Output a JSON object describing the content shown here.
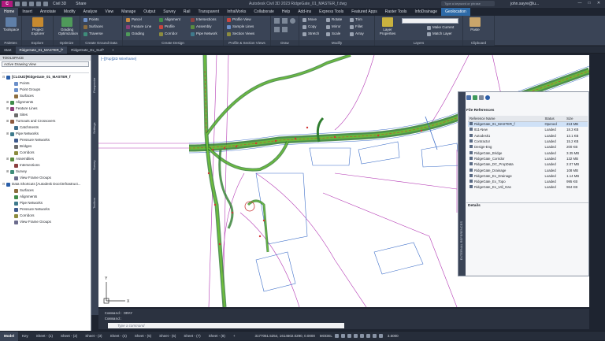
{
  "titlebar": {
    "logo": "C",
    "app_name": "Civil 3D",
    "share": "Share",
    "window_title": "Autodesk Civil 3D 2023   RidgeGate_01_MASTER_f.dwg",
    "search_placeholder": "Type a keyword or phrase",
    "user": "john.sayre@lu...",
    "minimize": "—",
    "maximize": "□",
    "close": "✕"
  },
  "tabs": [
    "Home",
    "Insert",
    "Annotate",
    "Modify",
    "Analyze",
    "View",
    "Manage",
    "Output",
    "Survey",
    "Rail",
    "Transparent",
    "InfraWorks",
    "Collaborate",
    "Help",
    "Add-ins",
    "Express Tools",
    "Featured Apps",
    "Raster Tools",
    "InfoDrainage",
    "Geolocation"
  ],
  "ribbon": {
    "palettes": {
      "title": "Palettes",
      "toolspace": "Toolspace"
    },
    "explore": {
      "title": "Explore",
      "project": "Project Explorer"
    },
    "optimize": {
      "title": "Optimize",
      "grading": "Grading Optimization"
    },
    "ground": {
      "title": "Create Ground Data",
      "items": [
        "Points",
        "Surfaces",
        "Traverse"
      ]
    },
    "design": {
      "title": "Create Design",
      "items": [
        "Parcel",
        "Feature Line",
        "Grading",
        "Alignment",
        "Profile",
        "Corridor",
        "Intersections",
        "Assembly",
        "Pipe Network"
      ]
    },
    "profile": {
      "title": "Profile & Section Views",
      "items": [
        "Profile View",
        "Sample Lines",
        "Section Views"
      ]
    },
    "draw": {
      "title": "Draw"
    },
    "modify": {
      "title": "Modify",
      "items": [
        "Move",
        "Copy",
        "Stretch",
        "Rotate",
        "Mirror",
        "Scale",
        "Trim",
        "Fillet",
        "Array"
      ]
    },
    "layers": {
      "title": "Layers",
      "props": "Layer Properties",
      "make_current": "Make Current",
      "match_layer": "Match Layer"
    },
    "clipboard": {
      "title": "Clipboard",
      "paste": "Paste"
    }
  },
  "doc_tabs": [
    "Start",
    "RidgeGate_01_MASTER_f*",
    "RidgeGate_Ex_Surf*",
    "+"
  ],
  "toolspace": {
    "header": "TOOLSPACE",
    "select": "Active Drawing View",
    "tree": [
      {
        "exp": "⊟",
        "label": "[CLOUD]RidgeGate_01_MASTER_f",
        "indent": 0,
        "color": "#2a5ea8",
        "bold": true
      },
      {
        "exp": "",
        "label": "Points",
        "indent": 2,
        "color": "#6b8fc9"
      },
      {
        "exp": "",
        "label": "Point Groups",
        "indent": 2,
        "color": "#6b8fc9"
      },
      {
        "exp": "",
        "label": "Surfaces",
        "indent": 2,
        "color": "#8c6d3f"
      },
      {
        "exp": "⊞",
        "label": "Alignments",
        "indent": 1,
        "color": "#3f8c4a"
      },
      {
        "exp": "⊞",
        "label": "Feature Lines",
        "indent": 1,
        "color": "#8c3f7a"
      },
      {
        "exp": "",
        "label": "Sites",
        "indent": 2,
        "color": "#6b6b6b"
      },
      {
        "exp": "⊞",
        "label": "Turnouts and Crossovers",
        "indent": 1,
        "color": "#8c5a3f"
      },
      {
        "exp": "",
        "label": "Catchments",
        "indent": 2,
        "color": "#3f6f8c"
      },
      {
        "exp": "⊞",
        "label": "Pipe Networks",
        "indent": 1,
        "color": "#3f7a8c"
      },
      {
        "exp": "",
        "label": "Pressure Networks",
        "indent": 2,
        "color": "#3f5a8c"
      },
      {
        "exp": "",
        "label": "Bridges",
        "indent": 2,
        "color": "#6b6b6b"
      },
      {
        "exp": "",
        "label": "Corridors",
        "indent": 2,
        "color": "#8c8c3f"
      },
      {
        "exp": "⊞",
        "label": "Assemblies",
        "indent": 1,
        "color": "#5a8c3f"
      },
      {
        "exp": "",
        "label": "Intersections",
        "indent": 2,
        "color": "#8c3f3f"
      },
      {
        "exp": "⊞",
        "label": "Survey",
        "indent": 1,
        "color": "#3f8c7a"
      },
      {
        "exp": "",
        "label": "View Frame Groups",
        "indent": 2,
        "color": "#6b6b8c"
      },
      {
        "exp": "⊟",
        "label": "Data Shortcuts [Autodesk Docs\\Infrastruct...",
        "indent": 0,
        "color": "#2a5ea8"
      },
      {
        "exp": "",
        "label": "Surfaces",
        "indent": 2,
        "color": "#8c6d3f"
      },
      {
        "exp": "",
        "label": "Alignments",
        "indent": 2,
        "color": "#3f8c4a"
      },
      {
        "exp": "",
        "label": "Pipe Networks",
        "indent": 2,
        "color": "#3f7a8c"
      },
      {
        "exp": "",
        "label": "Pressure Networks",
        "indent": 2,
        "color": "#3f5a8c"
      },
      {
        "exp": "",
        "label": "Corridors",
        "indent": 2,
        "color": "#8c8c3f"
      },
      {
        "exp": "",
        "label": "View Frame Groups",
        "indent": 2,
        "color": "#6b6b8c"
      }
    ]
  },
  "side_tabs": [
    "Prospector",
    "Settings",
    "Survey",
    "Toolbox"
  ],
  "viewport": {
    "label": "[–][Top][2D Wireframe]",
    "axis_x": "X",
    "axis_y": "Y"
  },
  "command": {
    "line1": "Command: DRAY",
    "line2": "Command:",
    "placeholder": "Type a command"
  },
  "status": {
    "tabs": [
      "Model",
      "Key",
      "Sheet - (1)",
      "Sheet - (2)",
      "Sheet - (3)",
      "Sheet - (4)",
      "Sheet - (5)",
      "Sheet - (6)",
      "Sheet - (7)",
      "Sheet - (8)",
      "+"
    ],
    "coords": "3177051.5254, 1614602.0290, 0.0000",
    "model": "MODEL",
    "scale": "3.5000"
  },
  "xref": {
    "strip_label": "EXTERNAL REFERENCES",
    "section": "File References",
    "col_name": "Reference Name",
    "col_status": "Status",
    "col_size": "Size",
    "rows": [
      {
        "name": "RidgeGate_01_MASTER_f",
        "status": "Opened",
        "size": "213 MB"
      },
      {
        "name": "811-New",
        "status": "Loaded",
        "size": "18.3 KB"
      },
      {
        "name": "Autodesk1",
        "status": "Loaded",
        "size": "13.1 KB"
      },
      {
        "name": "Contractor",
        "status": "Loaded",
        "size": "15.2 KB"
      },
      {
        "name": "Design-Eng",
        "status": "Loaded",
        "size": "200 KB"
      },
      {
        "name": "RidgeGate_Bridge",
        "status": "Loaded",
        "size": "3.35 MB"
      },
      {
        "name": "RidgeGate_Corridor",
        "status": "Loaded",
        "size": "132 MB"
      },
      {
        "name": "RidgeGate_DC_PropData",
        "status": "Loaded",
        "size": "2.07 MB"
      },
      {
        "name": "RidgeGate_Drainage",
        "status": "Loaded",
        "size": "108 MB"
      },
      {
        "name": "RidgeGate_Ex_Drainage",
        "status": "Loaded",
        "size": "1.14 MB"
      },
      {
        "name": "RidgeGate_Ex_Topo",
        "status": "Loaded",
        "size": "995 KB"
      },
      {
        "name": "RidgeGate_Ex_Util_Gas",
        "status": "Loaded",
        "size": "964 KB"
      }
    ],
    "details": "Details"
  }
}
